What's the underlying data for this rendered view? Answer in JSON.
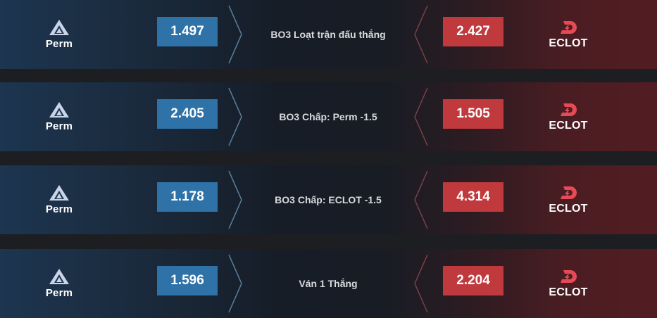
{
  "matches": [
    {
      "home_team": "Perm",
      "home_odds": "1.497",
      "market": "BO3 Loạt trận đấu thắng",
      "away_odds": "2.427",
      "away_team": "ECLOT"
    },
    {
      "home_team": "Perm",
      "home_odds": "2.405",
      "market": "BO3 Chấp: Perm -1.5",
      "away_odds": "1.505",
      "away_team": "ECLOT"
    },
    {
      "home_team": "Perm",
      "home_odds": "1.178",
      "market": "BO3 Chấp: ECLOT -1.5",
      "away_odds": "4.314",
      "away_team": "ECLOT"
    },
    {
      "home_team": "Perm",
      "home_odds": "1.596",
      "market": "Ván 1 Thắng",
      "away_odds": "2.204",
      "away_team": "ECLOT"
    }
  ],
  "colors": {
    "home_odds_bg": "#2f72a8",
    "away_odds_bg": "#c0393d",
    "eclot_logo": "#e84a55",
    "perm_logo": "#c9d4e8"
  },
  "icons": {
    "home_logo": "perm-logo-icon",
    "away_logo": "eclot-logo-icon",
    "divider": "chevron-divider-icon"
  }
}
